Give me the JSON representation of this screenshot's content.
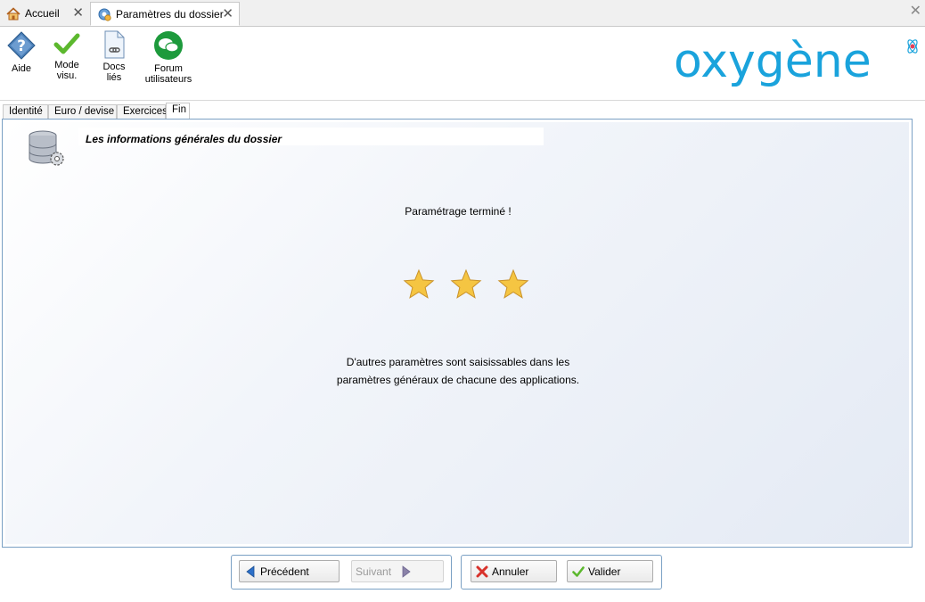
{
  "doc_tabs": [
    {
      "label": "Accueil"
    },
    {
      "label": "Paramètres du dossier"
    }
  ],
  "toolbar": {
    "aide": "Aide",
    "mode_l1": "Mode",
    "mode_l2": "visu.",
    "docs_l1": "Docs",
    "docs_l2": "liés",
    "forum_l1": "Forum",
    "forum_l2": "utilisateurs"
  },
  "logo": {
    "text": "oxygène",
    "color": "#1aa3dc"
  },
  "inner_tabs": [
    {
      "label": "Identité"
    },
    {
      "label": "Euro / devise"
    },
    {
      "label": "Exercices"
    },
    {
      "label": "Fin"
    }
  ],
  "main": {
    "heading": "Les informations générales du dossier",
    "message": "Paramétrage terminé !",
    "stars": 3,
    "info_l1": "D'autres paramètres sont saisissables dans les",
    "info_l2": "paramètres généraux de chacune des applications."
  },
  "buttons": {
    "previous": "Précédent",
    "next": "Suivant",
    "cancel": "Annuler",
    "validate": "Valider"
  },
  "colors": {
    "accent_border": "#7aa0c4",
    "star": "#f5c542",
    "forum_green": "#1d9a3c",
    "check_green": "#5cb82e"
  }
}
